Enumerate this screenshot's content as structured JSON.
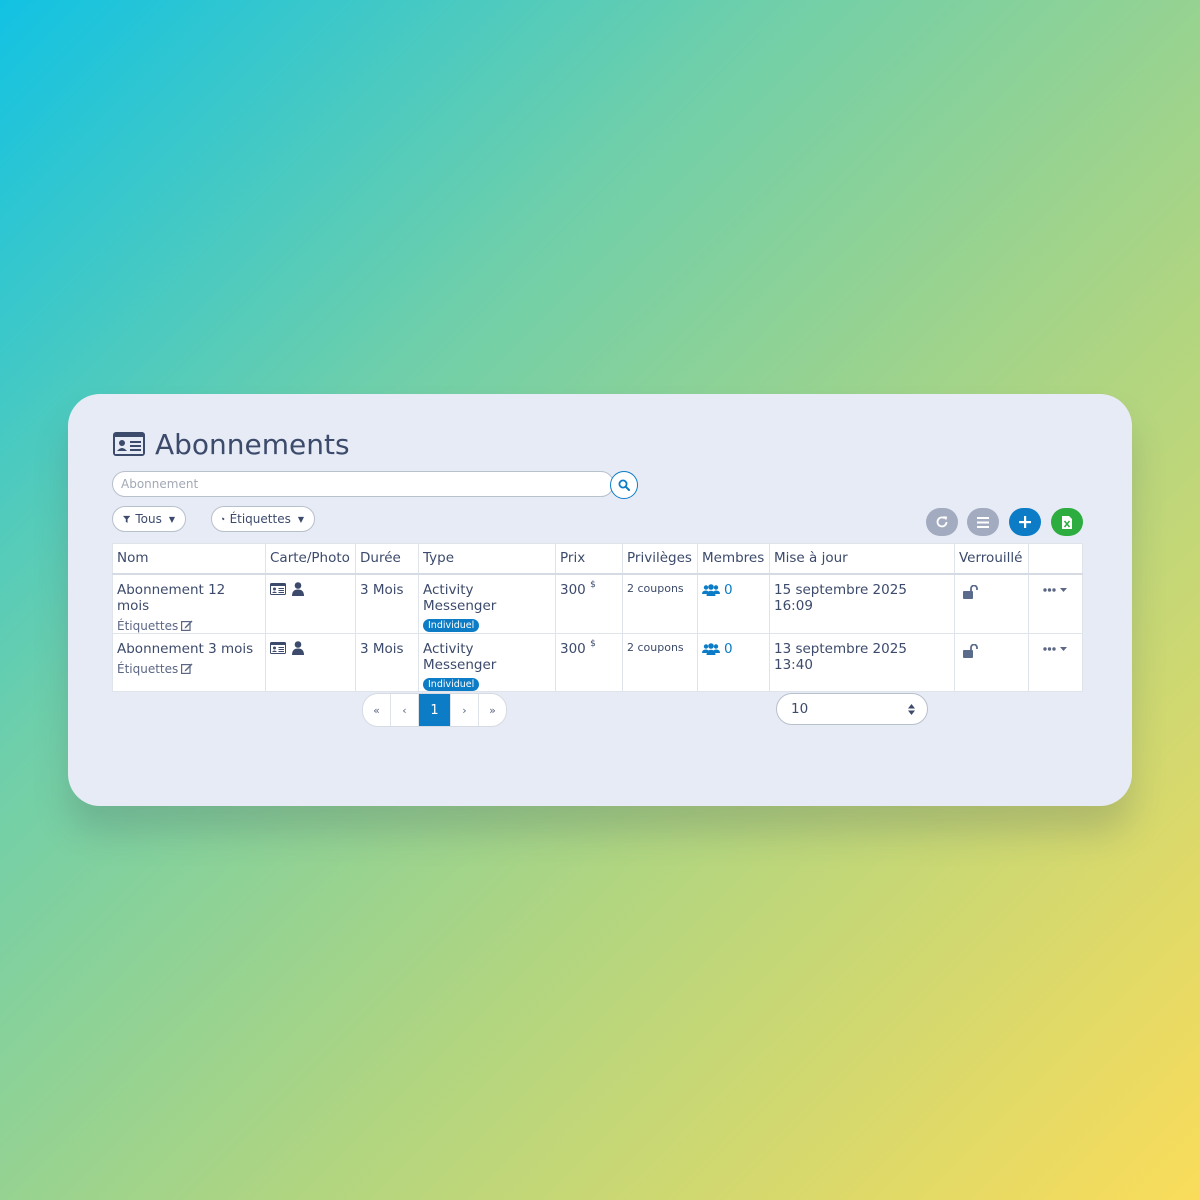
{
  "page": {
    "title": "Abonnements",
    "title_icon": "id-card-icon"
  },
  "search": {
    "placeholder": "Abonnement",
    "value": ""
  },
  "filters": {
    "status_label": "Tous",
    "tags_label": "Étiquettes"
  },
  "toolbar": {
    "refresh_icon": "refresh-icon",
    "columns_icon": "list-icon",
    "add_icon": "plus-icon",
    "export_icon": "excel-icon"
  },
  "colors": {
    "accent": "#0d7cc6",
    "grey_button": "#a2abbf",
    "export_green": "#2dad3f",
    "text": "#3c4a6b"
  },
  "table": {
    "headers": [
      "Nom",
      "Carte/Photo",
      "Durée",
      "Type",
      "Prix",
      "Privilèges",
      "Membres",
      "Mise à jour",
      "Verrouillé",
      ""
    ],
    "rows": [
      {
        "name": "Abonnement 12 mois",
        "tags_link": "Étiquettes",
        "duration": "3 Mois",
        "type": "Activity Messenger",
        "type_badge": "Individuel",
        "price": "300",
        "currency": "$",
        "privileges": "2 coupons",
        "members": "0",
        "updated": "15 septembre 2025 16:09",
        "locked": false
      },
      {
        "name": "Abonnement 3 mois",
        "tags_link": "Étiquettes",
        "duration": "3 Mois",
        "type": "Activity Messenger",
        "type_badge": "Individuel",
        "price": "300",
        "currency": "$",
        "privileges": "2 coupons",
        "members": "0",
        "updated": "13 septembre 2025 13:40",
        "locked": false
      }
    ]
  },
  "pagination": {
    "first": "«",
    "prev": "‹",
    "current": "1",
    "next": "›",
    "last": "»"
  },
  "page_size": {
    "selected": "10"
  }
}
